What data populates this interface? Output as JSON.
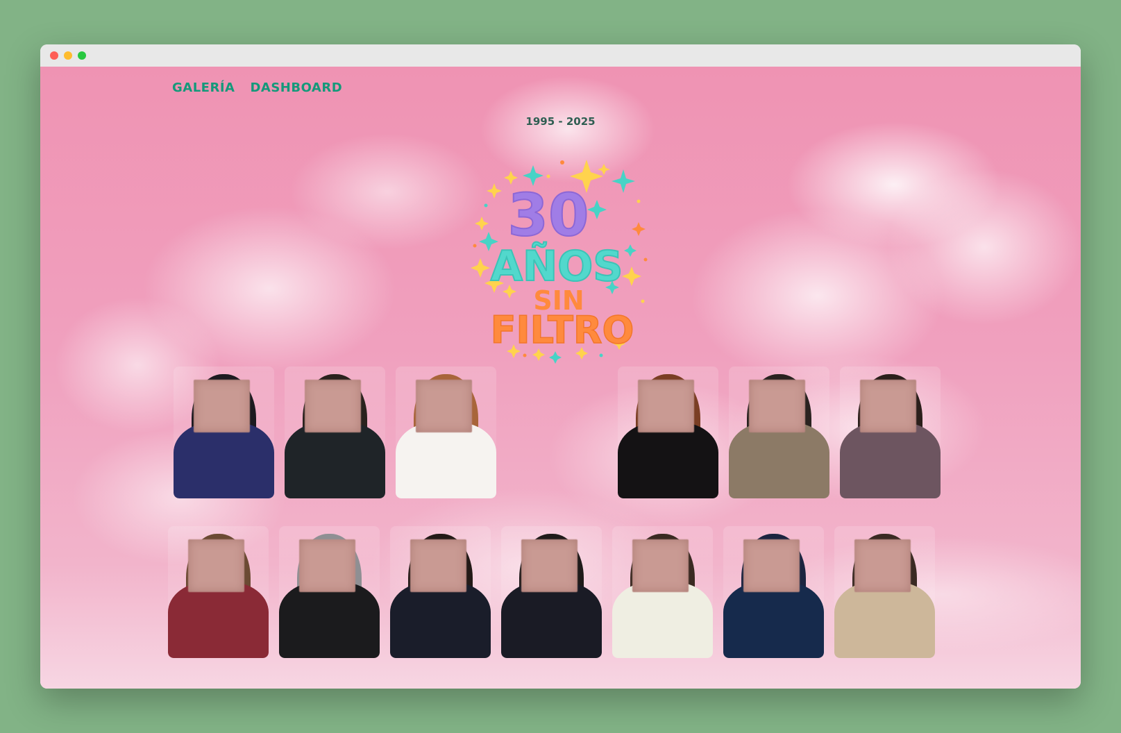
{
  "nav": {
    "links": [
      {
        "label": "GALERÍA"
      },
      {
        "label": "DASHBOARD"
      }
    ]
  },
  "hero": {
    "years": "1995 - 2025",
    "logo": {
      "line1": "30",
      "line2": "AÑOS",
      "line3": "SIN",
      "line4": "FILTRO"
    }
  },
  "gallery": {
    "row1": [
      {
        "hair": "#1d1a20",
        "body": "#2b2f6a"
      },
      {
        "hair": "#2a221e",
        "body": "#1f2428"
      },
      {
        "hair": "#a8653a",
        "body": "#f6f3f0"
      },
      {
        "spacer": true
      },
      {
        "hair": "#7a3e24",
        "body": "#141214"
      },
      {
        "hair": "#2a2320",
        "body": "#8c7a66"
      },
      {
        "hair": "#2b1f1b",
        "body": "#6d5560"
      }
    ],
    "row2": [
      {
        "hair": "#6b4a33",
        "body": "#8a2a36"
      },
      {
        "hair": "#8f8f93",
        "body": "#1b1b1d"
      },
      {
        "hair": "#231a17",
        "body": "#1a1d2a"
      },
      {
        "hair": "#1f1b1a",
        "body": "#1a1b25"
      },
      {
        "hair": "#3a2a22",
        "body": "#efeee2"
      },
      {
        "hair": "#1b2440",
        "body": "#162a4c"
      },
      {
        "hair": "#3a2a23",
        "body": "#cdb79a"
      }
    ]
  },
  "colors": {
    "nav": "#14997a",
    "years": "#2f5e52",
    "logo_purple": "#a07de6",
    "logo_teal": "#52d8cc",
    "logo_orange": "#ff8a3d",
    "star_yellow": "#ffd34d",
    "star_teal": "#47d3c6"
  }
}
